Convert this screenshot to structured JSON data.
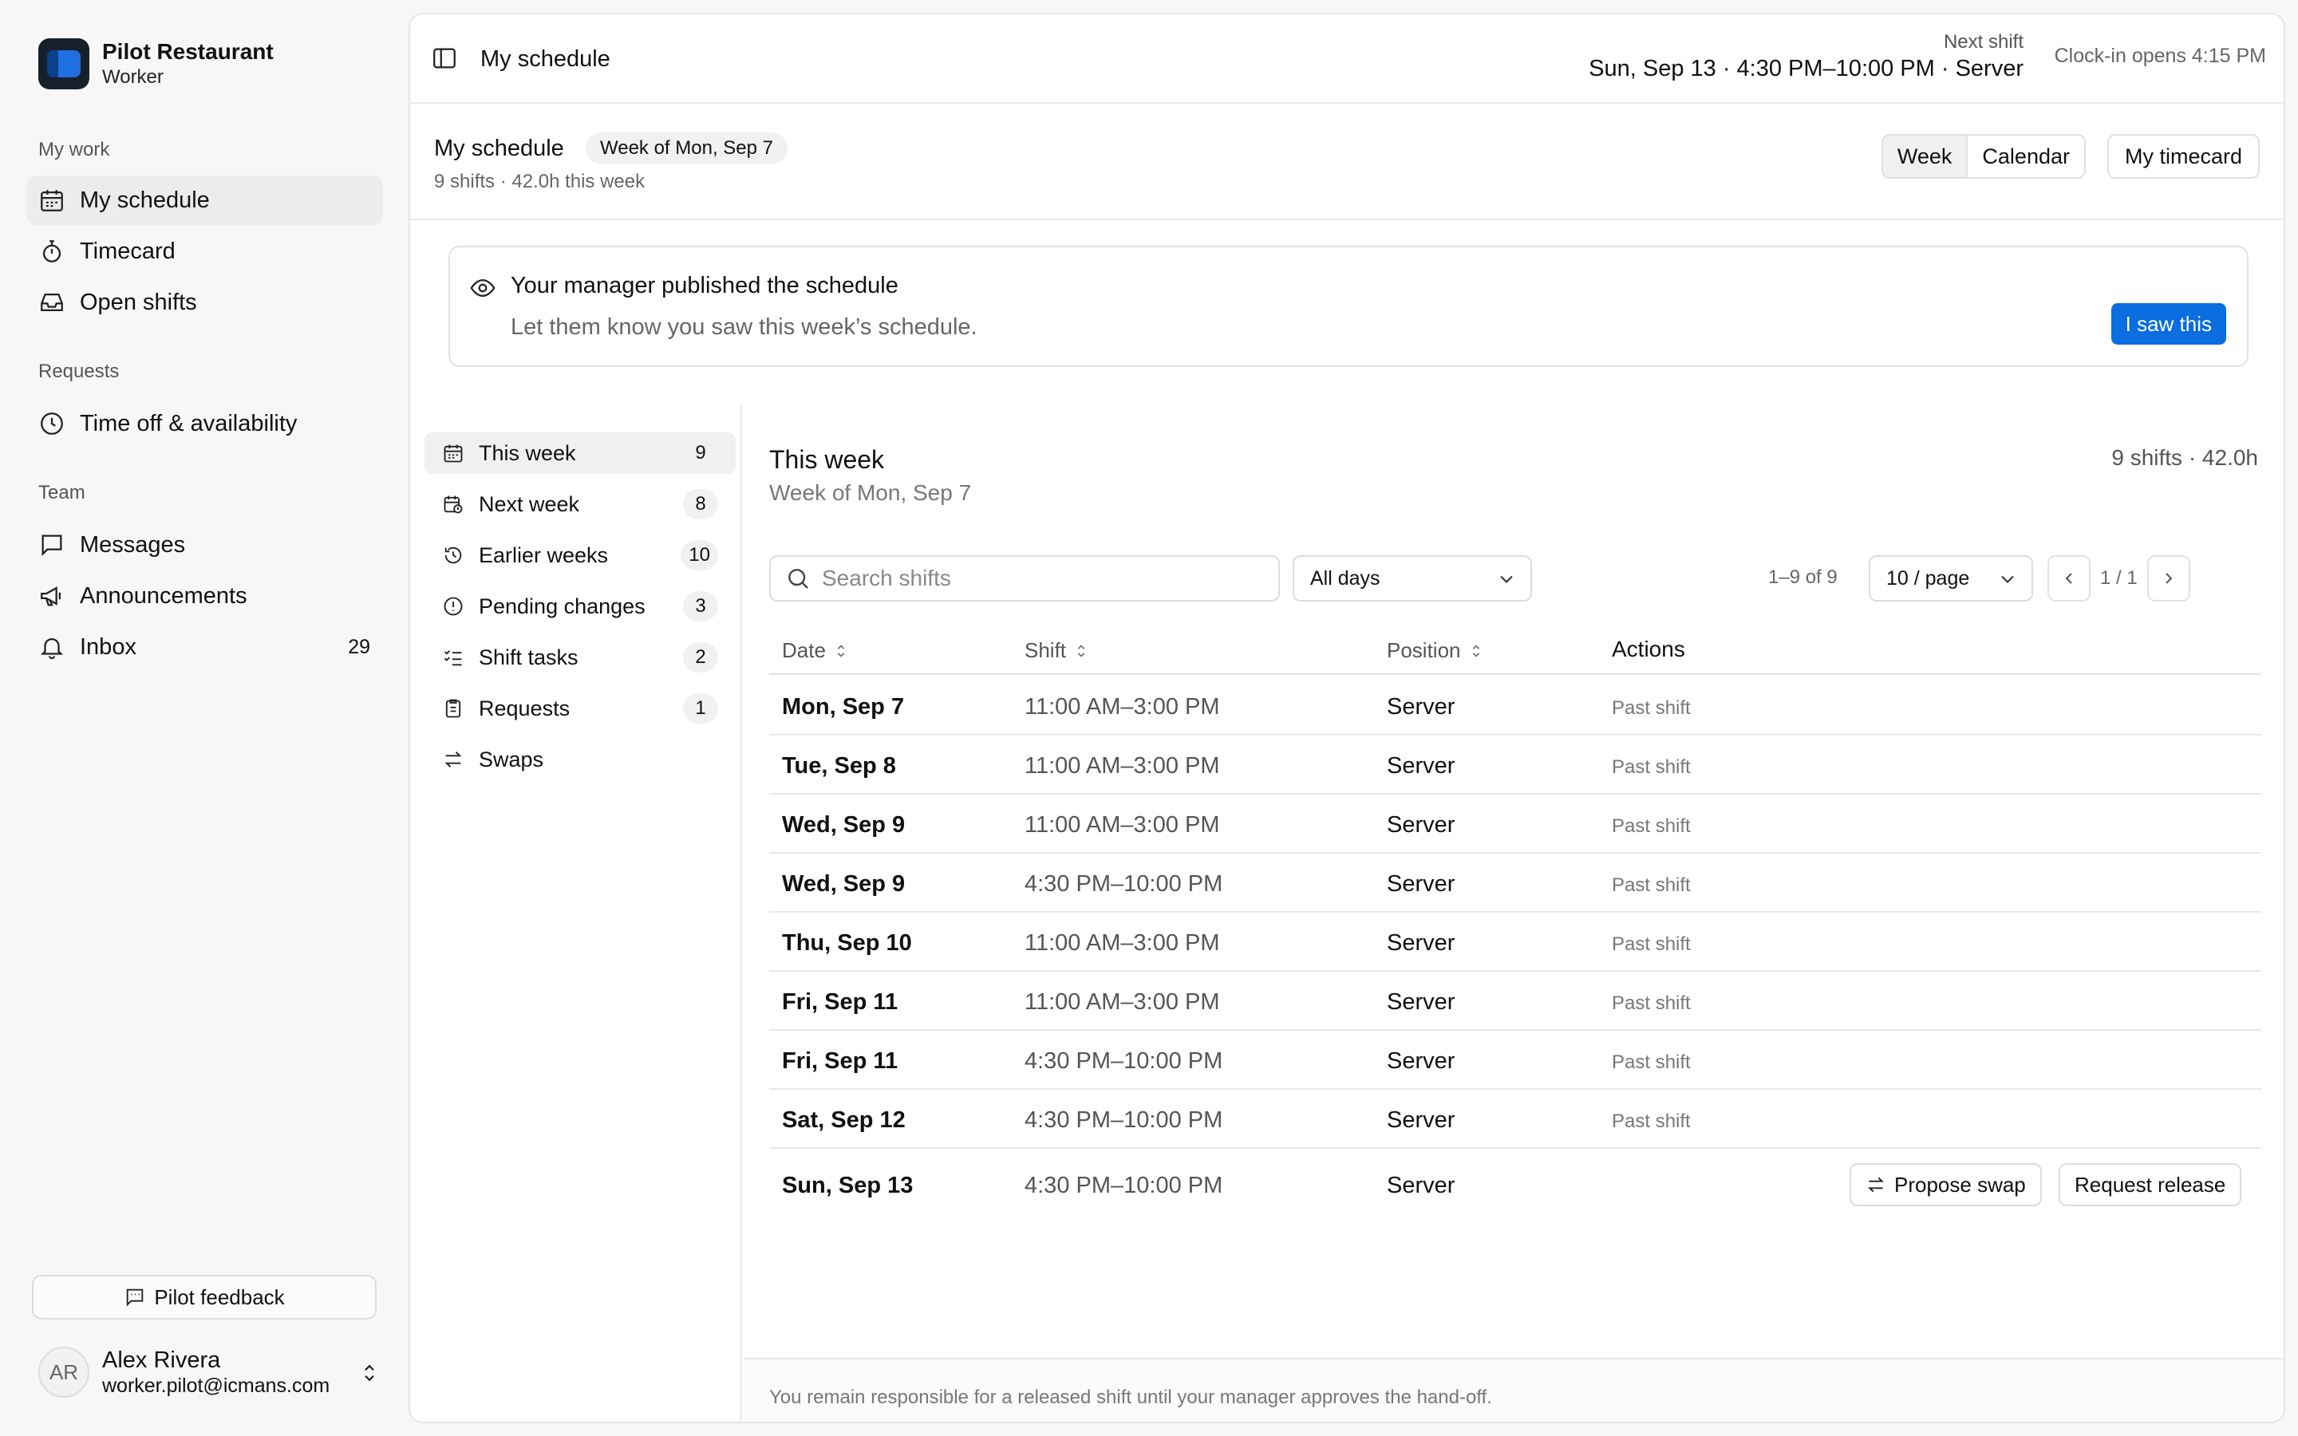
{
  "brand": {
    "name": "Pilot Restaurant",
    "role": "Worker"
  },
  "sidebar": {
    "sections": [
      {
        "label": "My work"
      },
      {
        "label": "Requests"
      },
      {
        "label": "Team"
      }
    ],
    "items": [
      {
        "label": "My schedule",
        "icon": "calendar-icon",
        "active": true
      },
      {
        "label": "Timecard",
        "icon": "stopwatch-icon"
      },
      {
        "label": "Open shifts",
        "icon": "inbox-tray-icon"
      },
      {
        "label": "Time off & availability",
        "icon": "clock-icon"
      },
      {
        "label": "Messages",
        "icon": "message-icon"
      },
      {
        "label": "Announcements",
        "icon": "megaphone-icon"
      },
      {
        "label": "Inbox",
        "icon": "bell-icon",
        "count": "29"
      }
    ],
    "feedback_label": "Pilot feedback",
    "user": {
      "initials": "AR",
      "name": "Alex Rivera",
      "email": "worker.pilot@icmans.com"
    }
  },
  "topbar": {
    "title": "My schedule",
    "next_shift_label": "Next shift",
    "next_shift_value": "Sun, Sep 13 · 4:30 PM–10:00 PM · Server",
    "clockin": "Clock-in opens 4:15 PM"
  },
  "subheader": {
    "title": "My schedule",
    "week_badge": "Week of Mon, Sep 7",
    "meta": "9 shifts · 42.0h this week",
    "view_week": "Week",
    "view_calendar": "Calendar",
    "timecard_label": "My timecard"
  },
  "notice": {
    "title": "Your manager published the schedule",
    "subtitle": "Let them know you saw this week’s schedule.",
    "button": "I saw this"
  },
  "submenu": [
    {
      "label": "This week",
      "count": "9",
      "icon": "calendar-icon",
      "active": true
    },
    {
      "label": "Next week",
      "count": "8",
      "icon": "calendar-clock-icon"
    },
    {
      "label": "Earlier weeks",
      "count": "10",
      "icon": "history-icon"
    },
    {
      "label": "Pending changes",
      "count": "3",
      "icon": "alert-circle-icon"
    },
    {
      "label": "Shift tasks",
      "count": "2",
      "icon": "checklist-icon"
    },
    {
      "label": "Requests",
      "count": "1",
      "icon": "clipboard-icon"
    },
    {
      "label": "Swaps",
      "icon": "swap-icon"
    }
  ],
  "content": {
    "title": "This week",
    "subtitle": "Week of Mon, Sep 7",
    "summary": "9 shifts · 42.0h",
    "search_placeholder": "Search shifts",
    "day_filter": "All days",
    "range": "1–9 of 9",
    "page_size": "10 / page",
    "page": "1 / 1",
    "columns": {
      "date": "Date",
      "shift": "Shift",
      "position": "Position",
      "actions": "Actions"
    },
    "rows": [
      {
        "date": "Mon, Sep 7",
        "shift": "11:00 AM–3:00 PM",
        "position": "Server",
        "status": "Past shift"
      },
      {
        "date": "Tue, Sep 8",
        "shift": "11:00 AM–3:00 PM",
        "position": "Server",
        "status": "Past shift"
      },
      {
        "date": "Wed, Sep 9",
        "shift": "11:00 AM–3:00 PM",
        "position": "Server",
        "status": "Past shift"
      },
      {
        "date": "Wed, Sep 9",
        "shift": "4:30 PM–10:00 PM",
        "position": "Server",
        "status": "Past shift"
      },
      {
        "date": "Thu, Sep 10",
        "shift": "11:00 AM–3:00 PM",
        "position": "Server",
        "status": "Past shift"
      },
      {
        "date": "Fri, Sep 11",
        "shift": "11:00 AM–3:00 PM",
        "position": "Server",
        "status": "Past shift"
      },
      {
        "date": "Fri, Sep 11",
        "shift": "4:30 PM–10:00 PM",
        "position": "Server",
        "status": "Past shift"
      },
      {
        "date": "Sat, Sep 12",
        "shift": "4:30 PM–10:00 PM",
        "position": "Server",
        "status": "Past shift"
      },
      {
        "date": "Sun, Sep 13",
        "shift": "4:30 PM–10:00 PM",
        "position": "Server",
        "swap_label": "Propose swap",
        "release_label": "Request release"
      }
    ],
    "footer_note": "You remain responsible for a released shift until your manager approves the hand-off."
  },
  "colors": {
    "accent": "#0a6de0",
    "brand_dark": "#16202b",
    "active_bg": "#ececee"
  }
}
